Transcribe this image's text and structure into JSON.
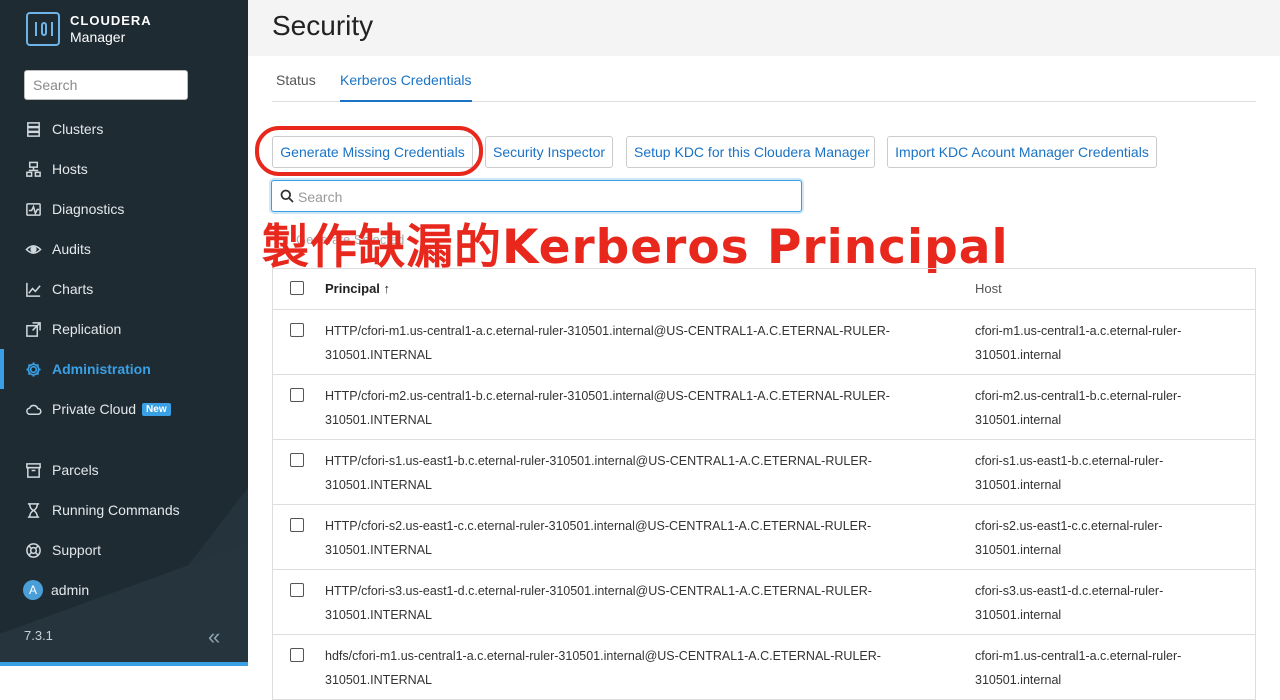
{
  "app": {
    "brand_line1": "CLOUDERA",
    "brand_line2": "Manager",
    "version": "7.3.1"
  },
  "sidebar": {
    "search_placeholder": "Search",
    "items": [
      {
        "label": "Clusters",
        "icon": "clusters-icon"
      },
      {
        "label": "Hosts",
        "icon": "hosts-icon"
      },
      {
        "label": "Diagnostics",
        "icon": "diagnostics-icon"
      },
      {
        "label": "Audits",
        "icon": "eye-icon"
      },
      {
        "label": "Charts",
        "icon": "chart-icon"
      },
      {
        "label": "Replication",
        "icon": "replication-icon"
      },
      {
        "label": "Administration",
        "icon": "gear-icon",
        "active": true
      },
      {
        "label": "Private Cloud",
        "icon": "cloud-icon",
        "badge": "New"
      },
      {
        "label": "Parcels",
        "icon": "parcel-icon"
      },
      {
        "label": "Running Commands",
        "icon": "hourglass-icon"
      },
      {
        "label": "Support",
        "icon": "support-icon"
      },
      {
        "label": "admin",
        "icon": "avatar",
        "avatar_letter": "A"
      }
    ]
  },
  "page": {
    "title": "Security",
    "tabs": [
      {
        "label": "Status",
        "active": false
      },
      {
        "label": "Kerberos Credentials",
        "active": true
      }
    ],
    "buttons": {
      "generate": "Generate Missing Credentials",
      "inspector": "Security Inspector",
      "setup_kdc": "Setup KDC for this Cloudera Manager",
      "import_kdc": "Import KDC Acount Manager Credentials"
    },
    "search_placeholder": "Search",
    "ghost_text": "Generate Selected",
    "annotation": "製作缺漏的Kerberos Principal"
  },
  "table": {
    "columns": {
      "principal": "Principal ↑",
      "host": "Host"
    },
    "rows": [
      {
        "principal": "HTTP/cfori-m1.us-central1-a.c.eternal-ruler-310501.internal@US-CENTRAL1-A.C.ETERNAL-RULER-310501.INTERNAL",
        "host": "cfori-m1.us-central1-a.c.eternal-ruler-310501.internal"
      },
      {
        "principal": "HTTP/cfori-m2.us-central1-b.c.eternal-ruler-310501.internal@US-CENTRAL1-A.C.ETERNAL-RULER-310501.INTERNAL",
        "host": "cfori-m2.us-central1-b.c.eternal-ruler-310501.internal"
      },
      {
        "principal": "HTTP/cfori-s1.us-east1-b.c.eternal-ruler-310501.internal@US-CENTRAL1-A.C.ETERNAL-RULER-310501.INTERNAL",
        "host": "cfori-s1.us-east1-b.c.eternal-ruler-310501.internal"
      },
      {
        "principal": "HTTP/cfori-s2.us-east1-c.c.eternal-ruler-310501.internal@US-CENTRAL1-A.C.ETERNAL-RULER-310501.INTERNAL",
        "host": "cfori-s2.us-east1-c.c.eternal-ruler-310501.internal"
      },
      {
        "principal": "HTTP/cfori-s3.us-east1-d.c.eternal-ruler-310501.internal@US-CENTRAL1-A.C.ETERNAL-RULER-310501.INTERNAL",
        "host": "cfori-s3.us-east1-d.c.eternal-ruler-310501.internal"
      },
      {
        "principal": "hdfs/cfori-m1.us-central1-a.c.eternal-ruler-310501.internal@US-CENTRAL1-A.C.ETERNAL-RULER-310501.INTERNAL",
        "host": "cfori-m1.us-central1-a.c.eternal-ruler-310501.internal"
      }
    ]
  },
  "colors": {
    "sidebar_bg": "#1f2b33",
    "accent": "#1a73c5",
    "annotation_red": "#e8281d"
  }
}
